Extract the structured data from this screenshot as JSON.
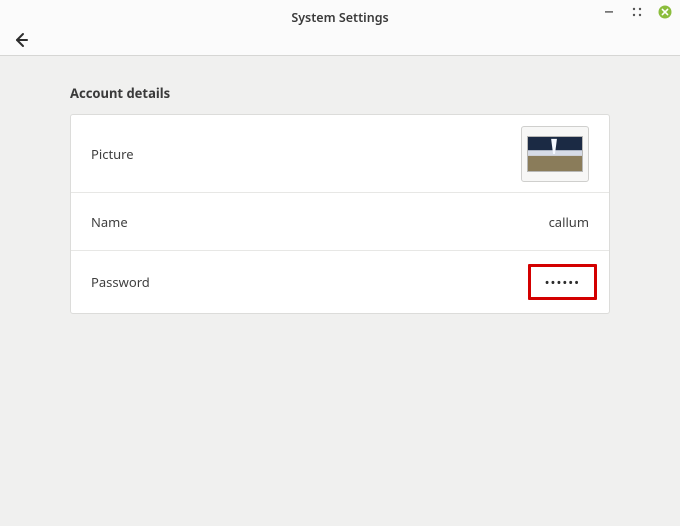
{
  "window": {
    "title": "System Settings"
  },
  "section": {
    "heading": "Account details"
  },
  "rows": {
    "picture": {
      "label": "Picture"
    },
    "name": {
      "label": "Name",
      "value": "callum"
    },
    "password": {
      "label": "Password",
      "value": "••••••"
    }
  }
}
